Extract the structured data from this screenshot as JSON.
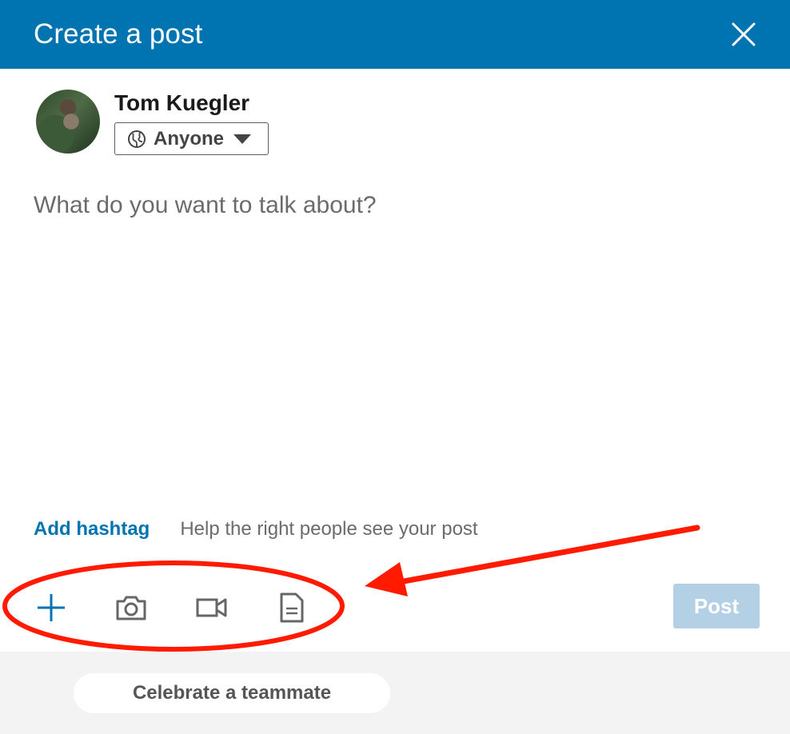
{
  "header": {
    "title": "Create a post",
    "close_icon": "close-icon",
    "background": "#0073b1"
  },
  "author": {
    "name": "Tom Kuegler",
    "visibility": {
      "selected": "Anyone",
      "icon": "globe-icon"
    }
  },
  "editor": {
    "placeholder": "What do you want to talk about?"
  },
  "hashtag": {
    "link_label": "Add hashtag",
    "hint": "Help the right people see your post"
  },
  "toolbar": {
    "tools": [
      {
        "icon": "plus-icon"
      },
      {
        "icon": "camera-icon"
      },
      {
        "icon": "video-camera-icon"
      },
      {
        "icon": "document-icon"
      }
    ],
    "post_label": "Post",
    "post_enabled": false
  },
  "footer": {
    "celebrate_label": "Celebrate a teammate"
  },
  "colors": {
    "accent": "#0073b1",
    "post_disabled": "#b4d0e5",
    "annotation_red": "#ff1a00"
  }
}
